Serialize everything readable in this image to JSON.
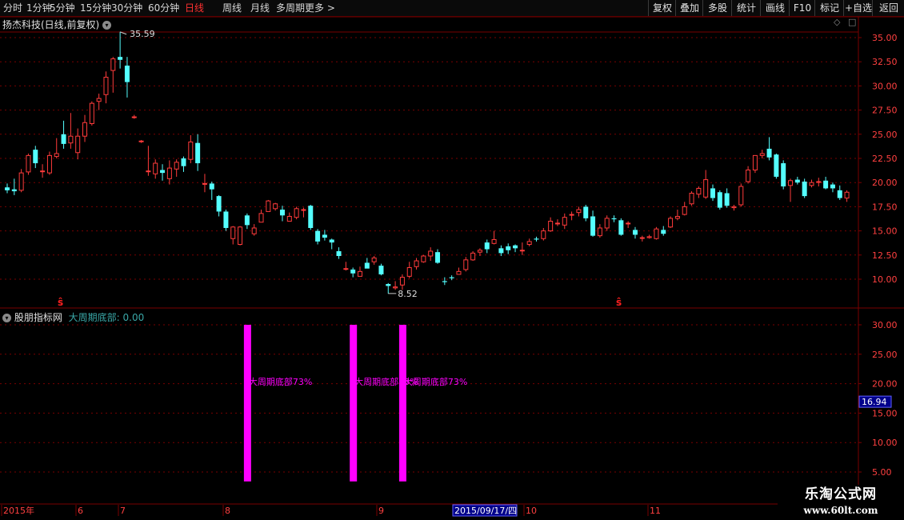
{
  "toolbar": {
    "periods": [
      "分时",
      "1分钟",
      "5分钟",
      "15分钟",
      "30分钟",
      "60分钟",
      "日线",
      "周线",
      "月线",
      "多周期",
      "更多 >"
    ],
    "active_period": "日线",
    "right_buttons": [
      "复权",
      "叠加",
      "多股",
      "统计",
      "画线",
      "F10",
      "标记",
      "+自选",
      "返回"
    ]
  },
  "kpanel": {
    "title": "扬杰科技(日线,前复权)",
    "high_label": "35.59",
    "low_label": "8.52",
    "diamond_icon": "◇",
    "close_icon": "□",
    "signal_glyph": "ŝ"
  },
  "indicator": {
    "name": "股朋指标网",
    "series_label": "大周期底部: 0.00",
    "current_value": "16.94",
    "bar_text": "大周期底部73%",
    "bar_color": "#ff00ff"
  },
  "axis_labels": {
    "price_ticks": [
      "35.00",
      "32.50",
      "30.00",
      "27.50",
      "25.00",
      "22.50",
      "20.00",
      "17.50",
      "15.00",
      "12.50",
      "10.00"
    ],
    "ind_ticks": [
      "30.00",
      "25.00",
      "20.00",
      "15.00",
      "10.00",
      "5.00"
    ],
    "date_labels": [
      "2015年",
      "6",
      "7",
      "8",
      "9",
      "10",
      "11"
    ],
    "cursor_date": "2015/09/17/四"
  },
  "watermark": {
    "title": "乐淘公式网",
    "url": "www.60lt.com"
  },
  "colors": {
    "up": "#ff3b3b",
    "down": "#54ffff",
    "grid": "#7a0000",
    "axis_text": "#ff4040",
    "accent": "#ff00ff"
  },
  "chart_data": {
    "type": "candlestick",
    "price_axis": {
      "ylim": [
        8.0,
        36.0
      ],
      "ticks": [
        10.0,
        12.5,
        15.0,
        17.5,
        20.0,
        22.5,
        25.0,
        27.5,
        30.0,
        32.5,
        35.0
      ]
    },
    "candles": [
      [
        19.5,
        19.2,
        19.9,
        18.9
      ],
      [
        19.3,
        19.1,
        20.4,
        18.7
      ],
      [
        19.2,
        21.0,
        21.4,
        19.0
      ],
      [
        21.1,
        22.8,
        23.0,
        20.8
      ],
      [
        23.4,
        22.0,
        23.8,
        21.5
      ],
      [
        21.2,
        21.2,
        21.9,
        20.5
      ],
      [
        21.0,
        22.8,
        23.2,
        20.8
      ],
      [
        22.7,
        23.0,
        24.6,
        22.5
      ],
      [
        25.0,
        24.0,
        26.4,
        23.5
      ],
      [
        24.1,
        24.8,
        27.2,
        23.5
      ],
      [
        23.1,
        24.8,
        25.6,
        22.4
      ],
      [
        24.8,
        26.2,
        27.0,
        24.2
      ],
      [
        26.1,
        28.2,
        28.4,
        25.9
      ],
      [
        28.4,
        28.7,
        29.2,
        27.5
      ],
      [
        29.1,
        30.9,
        31.5,
        28.2
      ],
      [
        31.6,
        32.8,
        33.0,
        29.3
      ],
      [
        33.0,
        32.7,
        35.6,
        31.8
      ],
      [
        32.1,
        30.4,
        33.0,
        28.8
      ],
      [
        26.8,
        26.8,
        27.0,
        26.6
      ],
      [
        24.3,
        24.3,
        24.4,
        24.1
      ],
      [
        21.2,
        21.2,
        23.8,
        20.7
      ],
      [
        20.9,
        22.0,
        22.4,
        20.4
      ],
      [
        21.3,
        21.0,
        21.9,
        20.2
      ],
      [
        20.4,
        21.5,
        22.3,
        19.8
      ],
      [
        21.4,
        22.1,
        22.4,
        20.6
      ],
      [
        22.5,
        21.7,
        22.7,
        21.1
      ],
      [
        22.4,
        24.2,
        24.9,
        22.0
      ],
      [
        24.1,
        22.0,
        25.0,
        21.2
      ],
      [
        19.9,
        19.9,
        20.9,
        19.0
      ],
      [
        19.9,
        19.3,
        20.1,
        18.2
      ],
      [
        18.6,
        17.0,
        18.7,
        16.5
      ],
      [
        17.0,
        15.3,
        17.2,
        15.0
      ],
      [
        14.2,
        15.4,
        15.5,
        13.6
      ],
      [
        13.6,
        15.4,
        15.5,
        13.5
      ],
      [
        16.6,
        15.6,
        16.8,
        15.2
      ],
      [
        14.7,
        15.3,
        15.7,
        14.5
      ],
      [
        15.9,
        16.8,
        17.2,
        15.9
      ],
      [
        17.0,
        18.1,
        18.2,
        17.2
      ],
      [
        17.3,
        17.8,
        17.9,
        17.1
      ],
      [
        17.2,
        16.6,
        17.6,
        16.0
      ],
      [
        16.0,
        16.5,
        16.9,
        16.2
      ],
      [
        16.4,
        17.3,
        17.5,
        16.2
      ],
      [
        17.2,
        17.2,
        17.4,
        16.4
      ],
      [
        17.6,
        15.3,
        17.7,
        15.1
      ],
      [
        15.0,
        13.9,
        15.2,
        13.6
      ],
      [
        14.6,
        14.3,
        15.1,
        14.0
      ],
      [
        14.1,
        13.8,
        14.2,
        13.1
      ],
      [
        12.9,
        12.4,
        13.3,
        12.1
      ],
      [
        11.1,
        11.1,
        11.8,
        10.9
      ],
      [
        11.0,
        10.6,
        11.2,
        10.2
      ],
      [
        10.3,
        10.8,
        11.3,
        10.4
      ],
      [
        11.7,
        11.1,
        12.2,
        11.2
      ],
      [
        11.8,
        12.2,
        12.4,
        11.5
      ],
      [
        11.4,
        10.5,
        11.6,
        10.4
      ],
      [
        9.5,
        9.3,
        9.6,
        8.5
      ],
      [
        9.1,
        9.2,
        9.8,
        8.9
      ],
      [
        9.4,
        10.2,
        10.5,
        8.9
      ],
      [
        10.3,
        11.2,
        11.8,
        10.1
      ],
      [
        11.3,
        11.9,
        12.2,
        11.0
      ],
      [
        11.8,
        12.4,
        12.5,
        11.7
      ],
      [
        12.4,
        12.9,
        13.3,
        11.9
      ],
      [
        12.8,
        11.7,
        13.1,
        11.6
      ],
      [
        9.8,
        9.7,
        10.2,
        9.4
      ],
      [
        10.2,
        10.1,
        10.4,
        9.9
      ],
      [
        10.5,
        10.8,
        11.2,
        10.5
      ],
      [
        11.0,
        12.0,
        12.3,
        10.8
      ],
      [
        12.0,
        12.7,
        12.9,
        11.9
      ],
      [
        12.8,
        13.0,
        13.2,
        12.4
      ],
      [
        13.8,
        13.1,
        14.1,
        12.7
      ],
      [
        13.7,
        14.1,
        15.0,
        13.6
      ],
      [
        13.2,
        12.7,
        13.5,
        12.4
      ],
      [
        13.4,
        13.0,
        13.7,
        12.6
      ],
      [
        13.5,
        13.2,
        13.6,
        12.8
      ],
      [
        13.0,
        13.0,
        13.8,
        12.5
      ],
      [
        13.6,
        13.9,
        14.2,
        13.4
      ],
      [
        14.2,
        14.1,
        14.4,
        13.9
      ],
      [
        14.2,
        15.0,
        15.3,
        14.0
      ],
      [
        15.0,
        16.0,
        16.4,
        14.9
      ],
      [
        15.8,
        15.8,
        16.2,
        15.5
      ],
      [
        15.6,
        16.4,
        16.8,
        15.2
      ],
      [
        16.7,
        16.7,
        17.0,
        16.1
      ],
      [
        16.9,
        17.2,
        17.5,
        16.5
      ],
      [
        17.5,
        16.3,
        17.7,
        16.0
      ],
      [
        16.5,
        14.5,
        17.1,
        14.4
      ],
      [
        14.5,
        15.3,
        15.7,
        14.3
      ],
      [
        15.3,
        16.3,
        16.6,
        15.0
      ],
      [
        16.3,
        16.2,
        16.6,
        15.9
      ],
      [
        16.1,
        14.6,
        16.3,
        14.5
      ],
      [
        15.8,
        15.8,
        16.0,
        15.3
      ],
      [
        15.1,
        14.6,
        15.4,
        14.2
      ],
      [
        14.3,
        14.3,
        14.5,
        13.9
      ],
      [
        14.3,
        14.4,
        14.6,
        14.2
      ],
      [
        14.2,
        15.2,
        15.4,
        14.1
      ],
      [
        15.1,
        14.7,
        15.5,
        14.5
      ],
      [
        15.4,
        16.3,
        16.5,
        15.3
      ],
      [
        16.3,
        16.5,
        17.2,
        16.1
      ],
      [
        16.7,
        17.5,
        18.0,
        16.6
      ],
      [
        17.8,
        18.9,
        19.1,
        17.6
      ],
      [
        18.8,
        19.4,
        19.6,
        18.4
      ],
      [
        18.5,
        20.3,
        21.3,
        18.3
      ],
      [
        19.4,
        18.4,
        19.8,
        18.1
      ],
      [
        19.0,
        17.4,
        19.2,
        17.2
      ],
      [
        18.9,
        17.6,
        19.4,
        17.4
      ],
      [
        17.4,
        17.5,
        17.7,
        17.1
      ],
      [
        17.7,
        19.6,
        19.9,
        17.5
      ],
      [
        20.1,
        21.3,
        21.7,
        19.9
      ],
      [
        21.3,
        22.8,
        22.8,
        21.0
      ],
      [
        22.8,
        23.0,
        23.4,
        22.5
      ],
      [
        23.5,
        22.6,
        24.7,
        22.3
      ],
      [
        22.9,
        20.6,
        23.0,
        20.4
      ],
      [
        22.0,
        19.6,
        22.3,
        19.3
      ],
      [
        19.7,
        20.2,
        20.4,
        18.0
      ],
      [
        20.3,
        20.0,
        20.6,
        19.8
      ],
      [
        20.1,
        18.6,
        20.4,
        18.4
      ],
      [
        19.7,
        20.0,
        20.3,
        19.5
      ],
      [
        20.1,
        20.1,
        20.5,
        19.6
      ],
      [
        20.2,
        19.4,
        20.6,
        19.3
      ],
      [
        19.8,
        19.4,
        20.0,
        19.0
      ],
      [
        19.2,
        18.4,
        19.7,
        18.2
      ],
      [
        18.4,
        19.0,
        19.2,
        18.0
      ]
    ],
    "indicator_axis": {
      "ylim": [
        3.0,
        31.0
      ],
      "ticks": [
        5,
        10,
        15,
        20,
        25,
        30
      ]
    },
    "indicator_bars": [
      {
        "index": 34,
        "value": 30.0,
        "label": "大周期底部73%"
      },
      {
        "index": 49,
        "value": 30.0,
        "label": "大周期底部73%"
      },
      {
        "index": 56,
        "value": 30.0,
        "label": "大周期底部73%"
      }
    ],
    "indicator_current": 16.94
  }
}
